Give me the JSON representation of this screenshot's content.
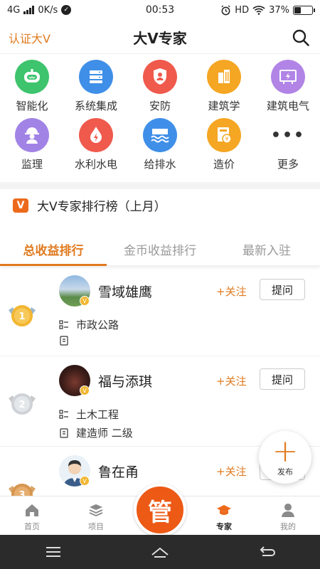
{
  "status_bar": {
    "network": "4G",
    "speed": "0K/s",
    "time": "00:53",
    "hd": "HD",
    "battery": "37%",
    "battery_level": 0.37
  },
  "header": {
    "left_label": "认证大V",
    "title": "大V专家"
  },
  "categories": [
    {
      "label": "智能化",
      "icon": "robot-icon",
      "color": "#3ec46d"
    },
    {
      "label": "系统集成",
      "icon": "server-icon",
      "color": "#3f8fe8"
    },
    {
      "label": "安防",
      "icon": "shield-icon",
      "color": "#ef5a4c"
    },
    {
      "label": "建筑学",
      "icon": "building-icon",
      "color": "#f5a623"
    },
    {
      "label": "建筑电气",
      "icon": "electric-panel-icon",
      "color": "#b184e6"
    },
    {
      "label": "监理",
      "icon": "worker-icon",
      "color": "#a183e6"
    },
    {
      "label": "水利水电",
      "icon": "water-drop-icon",
      "color": "#ef5a4c"
    },
    {
      "label": "给排水",
      "icon": "waves-icon",
      "color": "#3f8fe8"
    },
    {
      "label": "造价",
      "icon": "cost-icon",
      "color": "#f5a623"
    },
    {
      "label": "更多",
      "icon": "more-icon",
      "color": "#333333"
    }
  ],
  "ranking": {
    "badge": "V",
    "title": "大V专家排行榜（上月）"
  },
  "tabs": [
    {
      "label": "总收益排行",
      "active": true
    },
    {
      "label": "金币收益排行",
      "active": false
    },
    {
      "label": "最新入驻",
      "active": false
    }
  ],
  "experts": [
    {
      "rank": "1",
      "name": "雪域雄鹰",
      "follow": "+关注",
      "ask": "提问",
      "field": "市政公路",
      "cert": "",
      "medal": "gold"
    },
    {
      "rank": "2",
      "name": "福与添琪",
      "follow": "+关注",
      "ask": "提问",
      "field": "土木工程",
      "cert": "建造师 二级",
      "medal": "silver"
    },
    {
      "rank": "3",
      "name": "鲁在甬",
      "follow": "+关注",
      "ask": "提问",
      "field": "",
      "cert": "",
      "medal": "bronze"
    }
  ],
  "fab": {
    "label": "发布"
  },
  "bottom_nav": [
    {
      "label": "首页",
      "icon": "home-icon"
    },
    {
      "label": "项目",
      "icon": "layers-icon"
    },
    {
      "label": "",
      "icon": "guan-center-icon"
    },
    {
      "label": "专家",
      "icon": "graduation-cap-icon"
    },
    {
      "label": "我的",
      "icon": "user-icon"
    }
  ],
  "center_button": {
    "label": "管"
  },
  "colors": {
    "accent": "#e07a1f",
    "brand": "#ec5a16"
  }
}
